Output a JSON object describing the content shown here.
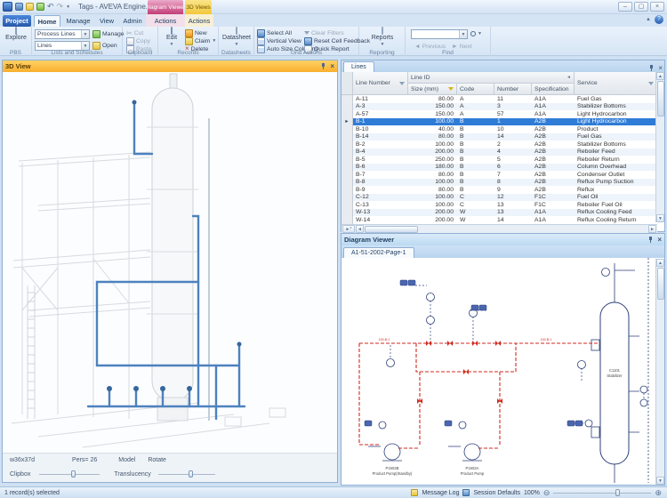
{
  "window": {
    "title": "Tags - AVEVA Engine...",
    "contextual_groups": [
      "Diagram Viewer",
      "3D Views"
    ],
    "buttons": {
      "minimize": "–",
      "maximize": "▢",
      "close": "×",
      "help": "?"
    }
  },
  "ribbon": {
    "tabs": [
      "Project",
      "Home",
      "Manage",
      "View",
      "Admin",
      "Actions",
      "Actions"
    ],
    "active_tab": "Home",
    "pbs": {
      "label": "PBS",
      "explore": "Explore"
    },
    "lists": {
      "label": "Lists and Schedules",
      "combo1": "Process Lines",
      "btn1": "Manage",
      "combo2": "Lines",
      "btn2": "Open"
    },
    "clipboard": {
      "label": "Clipboard",
      "items": [
        "Cut",
        "Copy",
        "Paste"
      ]
    },
    "records": {
      "label": "Records",
      "edit": "Edit",
      "items": [
        "New",
        "Claim",
        "Delete"
      ]
    },
    "datasheets": {
      "label": "Datasheets",
      "datasheet": "Datasheet"
    },
    "grid_actions": {
      "label": "Grid Actions",
      "col1": [
        "Select All",
        "Vertical View",
        "Auto Size Columns"
      ],
      "col2": [
        "Clear Filters",
        "Reset Cell Feedback",
        "Quick Report"
      ]
    },
    "reporting": {
      "label": "Reporting",
      "reports": "Reports"
    },
    "find": {
      "label": "Find",
      "search_value": "",
      "prev": "Previous",
      "next": "Next"
    }
  },
  "panel_3d": {
    "title": "3D View",
    "toolbar": {
      "size": "w36x37d",
      "pers": "Pers= 26",
      "model": "Model",
      "rotate": "Rotate"
    },
    "sliders": {
      "clipbox": "Clipbox",
      "translucency": "Translucency"
    }
  },
  "grid": {
    "tab": "Lines",
    "columns": {
      "line_number": "Line Number",
      "group": "Line ID",
      "size": "Size (mm)",
      "code": "Code",
      "number": "Number",
      "specification": "Specification",
      "service": "Service"
    },
    "rows": [
      {
        "line_number": "A-11",
        "size": "80.00",
        "code": "A",
        "number": "11",
        "spec": "A1A",
        "service": "Fuel Gas",
        "selected": false
      },
      {
        "line_number": "A-3",
        "size": "150.00",
        "code": "A",
        "number": "3",
        "spec": "A1A",
        "service": "Stabilizer Bottoms",
        "selected": false
      },
      {
        "line_number": "A-57",
        "size": "150.00",
        "code": "A",
        "number": "57",
        "spec": "A1A",
        "service": "Light Hydrocarbon",
        "selected": false
      },
      {
        "line_number": "B-1",
        "size": "100.00",
        "code": "B",
        "number": "1",
        "spec": "A2B",
        "service": "Light Hydrocarbon",
        "selected": true
      },
      {
        "line_number": "B-10",
        "size": "40.00",
        "code": "B",
        "number": "10",
        "spec": "A2B",
        "service": "Product",
        "selected": false
      },
      {
        "line_number": "B-14",
        "size": "80.00",
        "code": "B",
        "number": "14",
        "spec": "A2B",
        "service": "Fuel Gas",
        "selected": false
      },
      {
        "line_number": "B-2",
        "size": "100.00",
        "code": "B",
        "number": "2",
        "spec": "A2B",
        "service": "Stabilizer Bottoms",
        "selected": false
      },
      {
        "line_number": "B-4",
        "size": "200.00",
        "code": "B",
        "number": "4",
        "spec": "A2B",
        "service": "Reboiler Feed",
        "selected": false
      },
      {
        "line_number": "B-5",
        "size": "250.00",
        "code": "B",
        "number": "5",
        "spec": "A2B",
        "service": "Reboiler Return",
        "selected": false
      },
      {
        "line_number": "B-6",
        "size": "180.00",
        "code": "B",
        "number": "6",
        "spec": "A2B",
        "service": "Column Overhead",
        "selected": false
      },
      {
        "line_number": "B-7",
        "size": "80.00",
        "code": "B",
        "number": "7",
        "spec": "A2B",
        "service": "Condenser Outlet",
        "selected": false
      },
      {
        "line_number": "B-8",
        "size": "100.00",
        "code": "B",
        "number": "8",
        "spec": "A2B",
        "service": "Reflux Pump Suction",
        "selected": false
      },
      {
        "line_number": "B-9",
        "size": "80.00",
        "code": "B",
        "number": "9",
        "spec": "A2B",
        "service": "Reflux",
        "selected": false
      },
      {
        "line_number": "C-12",
        "size": "100.00",
        "code": "C",
        "number": "12",
        "spec": "F1C",
        "service": "Fuel Oil",
        "selected": false
      },
      {
        "line_number": "C-13",
        "size": "100.00",
        "code": "C",
        "number": "13",
        "spec": "F1C",
        "service": "Reboiler Fuel Oil",
        "selected": false
      },
      {
        "line_number": "W-13",
        "size": "200.00",
        "code": "W",
        "number": "13",
        "spec": "A1A",
        "service": "Reflux Cooling Feed",
        "selected": false
      },
      {
        "line_number": "W-14",
        "size": "200.00",
        "code": "W",
        "number": "14",
        "spec": "A1A",
        "service": "Reflux Cooling Return",
        "selected": false
      }
    ]
  },
  "diagram": {
    "title": "Diagram Viewer",
    "tab": "A1-51-2002-Page-1",
    "labels": {
      "vessel_tag": "C1101",
      "vessel_name": "Stabilizer",
      "pump_b_tag": "P1502B",
      "pump_b_name": "Product Pump(Standby)",
      "pump_a_tag": "P1502A",
      "pump_a_name": "Product Pump",
      "line_tag": "100-B-1"
    },
    "colors": {
      "highlight": "#d02b20",
      "line": "#2c3f78"
    }
  },
  "status": {
    "left": "1 record(s) selected",
    "message_log": "Message Log",
    "session_defaults": "Session Defaults",
    "zoom": "100%"
  }
}
